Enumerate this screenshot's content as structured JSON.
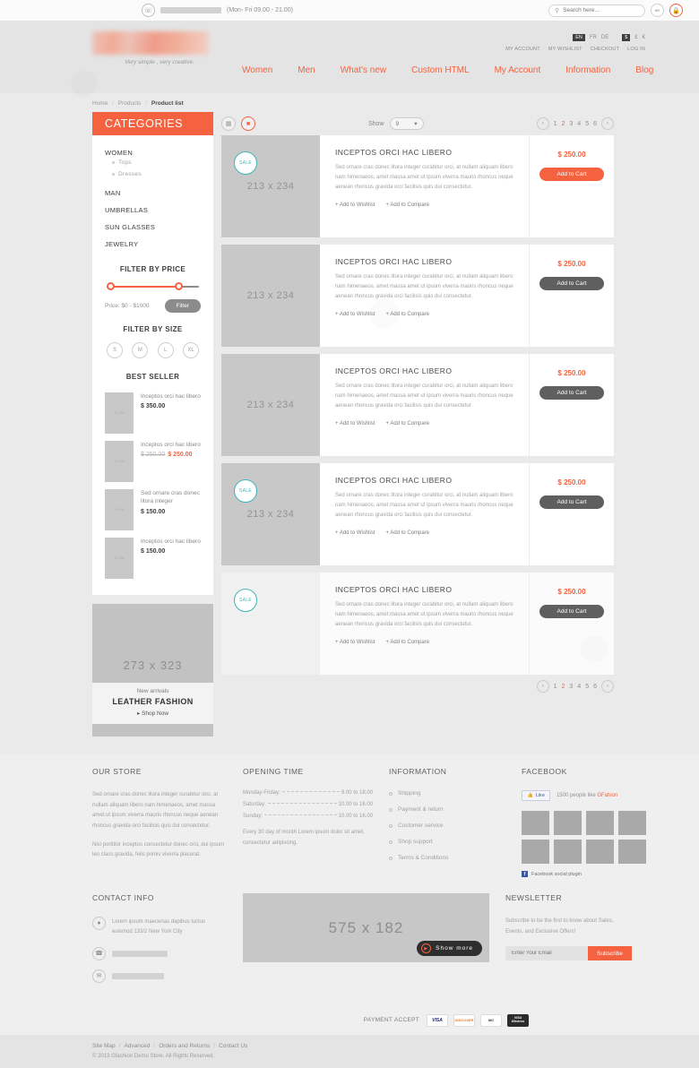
{
  "topbar": {
    "hours": "(Mon- Fri 09.00 - 21.00)",
    "search_placeholder": "Search here...",
    "share_icon": "share-icon",
    "cart_icon": "lock-cart-icon"
  },
  "header": {
    "tagline": "Very simple , very creative.",
    "languages": [
      "EN",
      "FR",
      "DE"
    ],
    "active_language": "EN",
    "currencies": [
      "$",
      "£",
      "€"
    ],
    "active_currency": "$",
    "account_links": [
      "MY ACCOUNT",
      "MY WISHLIST",
      "CHECKOUT",
      "LOG IN"
    ],
    "nav": [
      "Women",
      "Men",
      "What's new",
      "Custom HTML",
      "My Account",
      "Information",
      "Blog"
    ]
  },
  "breadcrumb": {
    "home": "Home",
    "products": "Products",
    "current": "Product list"
  },
  "sidebar": {
    "categories_title": "CATEGORIES",
    "categories": [
      {
        "label": "WOMEN",
        "sub": [
          "Tops",
          "Dresses"
        ]
      },
      {
        "label": "MAN",
        "sub": []
      },
      {
        "label": "UMBRELLAS",
        "sub": []
      },
      {
        "label": "SUN GLASSES",
        "sub": []
      },
      {
        "label": "JEWELRY",
        "sub": []
      }
    ],
    "filter_price_title": "FILTER BY PRICE",
    "price_label": "Price: $0 - $1000",
    "filter_button": "Filter",
    "filter_size_title": "FILTER BY SIZE",
    "sizes": [
      "S",
      "M",
      "L",
      "XL"
    ],
    "best_seller_title": "BEST SELLER",
    "best_sellers": [
      {
        "thumb": "70 x 80",
        "name": "Inceptos orci hac libero",
        "price": "$ 350.00",
        "old_price": "",
        "sale": false
      },
      {
        "thumb": "70 x 80",
        "name": "Inceptos orci hac libero",
        "price": "$ 250.00",
        "old_price": "$ 250.00",
        "sale": true
      },
      {
        "thumb": "70 x 80",
        "name": "Sed ornare cras donec litora integer",
        "price": "$ 150.00",
        "old_price": "",
        "sale": false
      },
      {
        "thumb": "70 x 80",
        "name": "Inceptos orci hac libero",
        "price": "$ 150.00",
        "old_price": "",
        "sale": false
      }
    ],
    "banner": {
      "placeholder": "273 x 323",
      "small": "New arrivals",
      "title": "LEATHER FASHION",
      "cta": "▸ Shop Now"
    }
  },
  "toolbar": {
    "show_label": "Show",
    "show_value": "9",
    "grid_icon": "grid-view-icon",
    "list_icon": "list-view-icon"
  },
  "pagination": {
    "prev": "‹",
    "next": "›",
    "pages": [
      "1",
      "2",
      "3",
      "4",
      "5",
      "6"
    ],
    "active": "2"
  },
  "products": [
    {
      "image": "213 x 234",
      "sale": true,
      "sale_label": "SALE",
      "title": "INCEPTOS ORCI HAC LIBERO",
      "description": "Sed ornare cras donec litora integer curabitur orci, at nullam aliquam libero nam himenaeos, amet massa amet ut ipsum viverra mauris rhoncus neque aenean rhoncus gravida orci facilisis quis dui consectetur.",
      "wishlist": "+ Add to Wishlist",
      "compare": "+ Add to Compare",
      "price": "$ 250.00",
      "cart_label": "Add to Cart",
      "cart_accent": true
    },
    {
      "image": "213 x 234",
      "sale": false,
      "sale_label": "SALE",
      "title": "INCEPTOS ORCI HAC LIBERO",
      "description": "Sed ornare cras donec litora integer curabitur orci, at nullam aliquam libero nam himenaeos, amet massa amet ut ipsum viverra mauris rhoncus neque aenean rhoncus gravida orci facilisis quis dui consectetur.",
      "wishlist": "+ Add to Wishlist",
      "compare": "+ Add to Compare",
      "price": "$ 250.00",
      "cart_label": "Add to Cart",
      "cart_accent": false
    },
    {
      "image": "213 x 234",
      "sale": false,
      "sale_label": "SALE",
      "title": "INCEPTOS ORCI HAC LIBERO",
      "description": "Sed ornare cras donec litora integer curabitur orci, at nullam aliquam libero nam himenaeos, amet massa amet ut ipsum viverra mauris rhoncus neque aenean rhoncus gravida orci facilisis quis dui consectetur.",
      "wishlist": "+ Add to Wishlist",
      "compare": "+ Add to Compare",
      "price": "$ 250.00",
      "cart_label": "Add to Cart",
      "cart_accent": false
    },
    {
      "image": "213 x 234",
      "sale": true,
      "sale_label": "SALE",
      "title": "INCEPTOS ORCI HAC LIBERO",
      "description": "Sed ornare cras donec litora integer curabitur orci, at nullam aliquam libero nam himenaeos, amet massa amet ut ipsum viverra mauris rhoncus neque aenean rhoncus gravida orci facilisis quis dui consectetur.",
      "wishlist": "+ Add to Wishlist",
      "compare": "+ Add to Compare",
      "price": "$ 250.00",
      "cart_label": "Add to Cart",
      "cart_accent": false
    },
    {
      "image": "",
      "sale": true,
      "sale_label": "SALE",
      "title": "INCEPTOS ORCI HAC LIBERO",
      "description": "Sed ornare cras donec litora integer curabitur orci, at nullam aliquam libero nam himenaeos, amet massa amet ut ipsum viverra mauris rhoncus neque aenean rhoncus gravida orci facilisis quis dui consectetur.",
      "wishlist": "+ Add to Wishlist",
      "compare": "+ Add to Compare",
      "price": "$ 250.00",
      "cart_label": "Add to Cart",
      "cart_accent": false
    }
  ],
  "footer": {
    "store": {
      "title": "OUR STORE",
      "p1": "Sed ornare cras donec litora integer curabitur orci, at nullam aliquam libero nam himenaeos, amet massa amet ut ipsum viverra mauris rhoncus neque aenean rhoncus gravida orci facilisis quis dui consectetur.",
      "p2": "Nisi porttitor inceptos consectetur donec orci, dui ipsum leo class gravida, felis primis viverra placerat."
    },
    "opening": {
      "title": "OPENING TIME",
      "rows": [
        {
          "day": "Monday-Friday:",
          "time": "9.00 to 18.00"
        },
        {
          "day": "Saturday:",
          "time": "10.00 to 16.00"
        },
        {
          "day": "Sunday:",
          "time": "10.00 to 16.00"
        }
      ],
      "note": "Every 30 day of month Lorem ipsum dolor sit amet, consectetur adipiscing."
    },
    "information": {
      "title": "INFORMATION",
      "links": [
        "Shipping",
        "Payment & return",
        "Customer service",
        "Shop support",
        "Terms & Conditions"
      ]
    },
    "facebook": {
      "title": "FACEBOOK",
      "like_label": "Like",
      "count_text": "1500 people like ",
      "brand": "GFahion",
      "plugin_text": "Facebook social plugin",
      "avatars": 8
    },
    "contact": {
      "title": "CONTACT INFO",
      "address": "Lorem ipsum maecenas dapibus luctus euismod 133/2 New York City",
      "location_icon": "location-pin-icon",
      "phone_icon": "phone-icon",
      "mail_icon": "mail-icon"
    },
    "promo": {
      "placeholder": "575 x 182",
      "show_more": "Show more"
    },
    "newsletter": {
      "title": "NEWSLETTER",
      "text": "Subscribe to be the first to know about Sales, Events, and Exclusive Offers!",
      "placeholder": "Enter Your Email",
      "button": "Subscribe"
    },
    "payment": {
      "label": "PAYMENT ACCEPT",
      "cards": [
        "VISA",
        "DISCOVER",
        "MasterCard",
        "VISA Electron"
      ]
    },
    "bottom_links": [
      "Site Map",
      "Advanced",
      "Orders and Returns",
      "Contact Us"
    ],
    "copyright": "© 2013 Gfashion Demo Store. All Rights Reserved."
  },
  "colors": {
    "accent": "#f4623f",
    "dark_button": "#5f5f5f",
    "teal": "#3fb6b6"
  }
}
